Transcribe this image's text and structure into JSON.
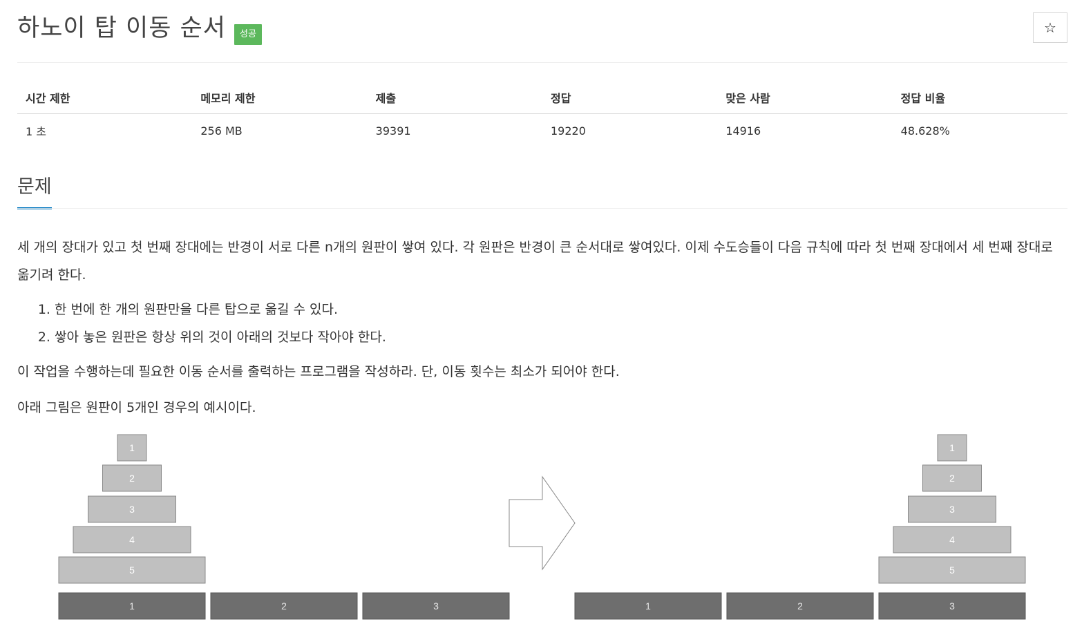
{
  "problem": {
    "title": "하노이 탑 이동 순서",
    "badge": "성공",
    "star_icon": "☆"
  },
  "stats": {
    "headers": [
      "시간 제한",
      "메모리 제한",
      "제출",
      "정답",
      "맞은 사람",
      "정답 비율"
    ],
    "values": [
      "1 초",
      "256 MB",
      "39391",
      "19220",
      "14916",
      "48.628%"
    ]
  },
  "section": {
    "title": "문제"
  },
  "description": {
    "intro": "세 개의 장대가 있고 첫 번째 장대에는 반경이 서로 다른 n개의 원판이 쌓여 있다. 각 원판은 반경이 큰 순서대로 쌓여있다. 이제 수도승들이 다음 규칙에 따라 첫 번째 장대에서 세 번째 장대로 옮기려 한다.",
    "rules": [
      "한 번에 한 개의 원판만을 다른 탑으로 옮길 수 있다.",
      "쌓아 놓은 원판은 항상 위의 것이 아래의 것보다 작아야 한다."
    ],
    "task": "이 작업을 수행하는데 필요한 이동 순서를 출력하는 프로그램을 작성하라. 단, 이동 횟수는 최소가 되어야 한다.",
    "example": "아래 그림은 원판이 5개인 경우의 예시이다."
  },
  "figure": {
    "disk_labels": [
      "1",
      "2",
      "3",
      "4",
      "5"
    ],
    "peg_labels": [
      "1",
      "2",
      "3"
    ],
    "disk_color": "#c0c0c0",
    "peg_color": "#6e6e6e"
  }
}
